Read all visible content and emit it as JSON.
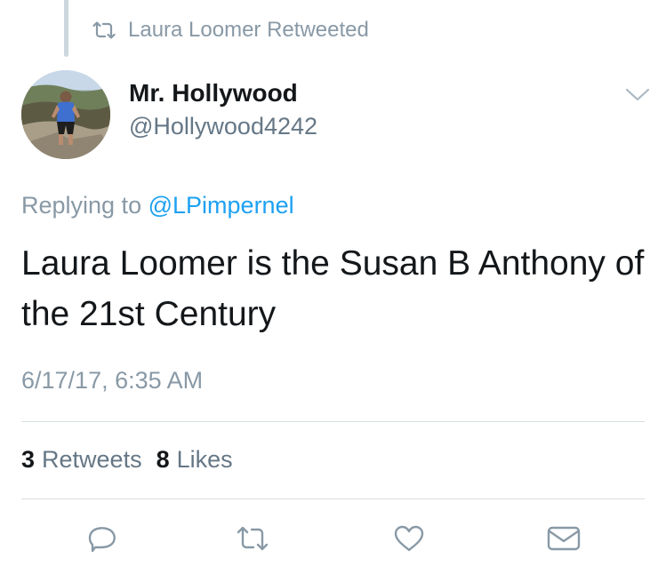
{
  "social_context": {
    "label": "Laura Loomer Retweeted",
    "icon": "retweet-icon"
  },
  "author": {
    "display_name": "Mr. Hollywood",
    "handle": "@Hollywood4242",
    "avatar": "profile-photo"
  },
  "reply_context": {
    "prefix": "Replying to",
    "mention": "@LPimpernel"
  },
  "tweet": {
    "text": "Laura Loomer is the Susan B Anthony of the 21st Century",
    "timestamp": "6/17/17, 6:35 AM"
  },
  "stats": {
    "retweets_count": "3",
    "retweets_label": "Retweets",
    "likes_count": "8",
    "likes_label": "Likes"
  },
  "actions": {
    "reply_icon": "reply-icon",
    "retweet_icon": "retweet-icon",
    "like_icon": "heart-icon",
    "dm_icon": "envelope-icon"
  },
  "colors": {
    "primary_text": "#14171a",
    "secondary_text": "#8899a6",
    "handle_text": "#657786",
    "mention": "#1da1f2",
    "icon": "#8899a6",
    "divider": "#d8dde1",
    "thread_line": "#ccd6dd"
  }
}
